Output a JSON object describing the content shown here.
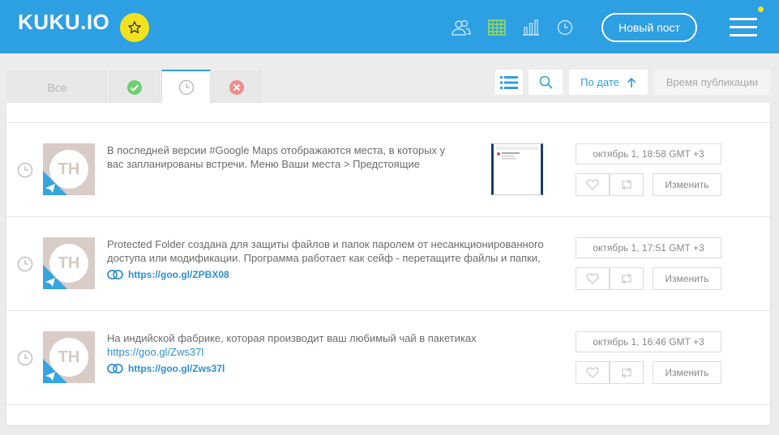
{
  "header": {
    "logo_text": "KUKU.IO",
    "new_post_label": "Новый пост",
    "accent": "#2d9fe3",
    "star_color": "#f2e21e"
  },
  "tabs": [
    {
      "label": "Все",
      "icon": "none"
    },
    {
      "label": "",
      "icon": "check-circle-icon"
    },
    {
      "label": "",
      "icon": "clock-icon"
    },
    {
      "label": "",
      "icon": "x-circle-icon"
    }
  ],
  "toolbar": {
    "sort_label": "По дате",
    "time_label": "Время публикации"
  },
  "posts": [
    {
      "avatar_initials": "TH",
      "text": "В последней версии #Google Maps отображаются места, в которых у вас запланированы встречи. Меню Ваши места > Предстоящие",
      "inline_link": "",
      "link": "",
      "has_thumb": true,
      "date": "октябрь 1, 18:58 GMT +3",
      "edit_label": "Изменить"
    },
    {
      "avatar_initials": "TH",
      "text": "Protected Folder создана для защиты файлов и папок паролем от несанкционированного доступа или модификации. Программа работает как сейф - перетащите файлы и папки,",
      "inline_link": "",
      "link": "https://goo.gl/ZPBX08",
      "has_thumb": false,
      "date": "октябрь 1, 17:51 GMT +3",
      "edit_label": "Изменить"
    },
    {
      "avatar_initials": "TH",
      "text": "На индийской фабрике, которая производит ваш любимый чай в пакетиках",
      "inline_link": "https://goo.gl/Zws37l",
      "link": "https://goo.gl/Zws37l",
      "has_thumb": false,
      "date": "октябрь 1, 16:46 GMT +3",
      "edit_label": "Изменить"
    }
  ]
}
